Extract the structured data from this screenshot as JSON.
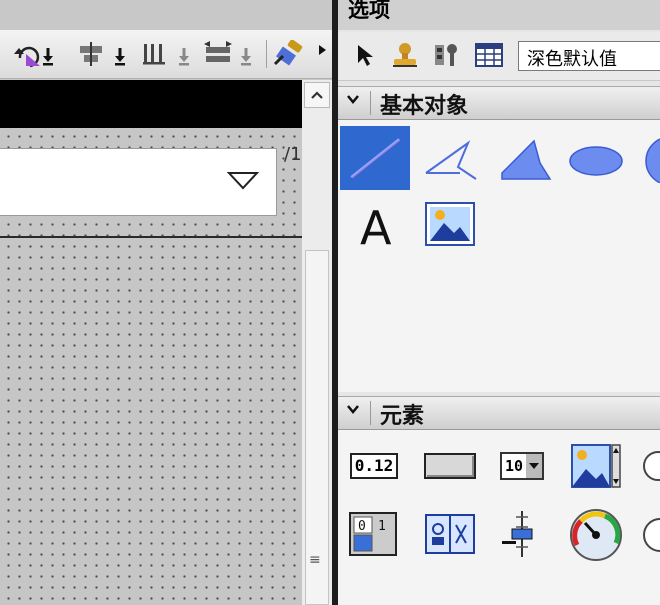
{
  "panel": {
    "title": "选项",
    "style_select_value": "深色默认值"
  },
  "sections": {
    "basic": "基本对象",
    "elements": "元素"
  },
  "canvas": {
    "text_fragment": "/1"
  },
  "elements": {
    "io_field_value": "0.12",
    "symbolic_io_value": "10"
  },
  "colors": {
    "selection": "#2f69cf",
    "shape_fill": "#6d8cf0",
    "splitter": "#1d1d1d"
  },
  "icons": [
    "pointer-icon",
    "user-stamp-icon",
    "settings-io-icon",
    "table-icon",
    "line-tool-icon",
    "polyline-tool-icon",
    "polygon-tool-icon",
    "ellipse-tool-icon",
    "circle-tool-icon",
    "text-tool-icon",
    "graphic-tool-icon"
  ]
}
